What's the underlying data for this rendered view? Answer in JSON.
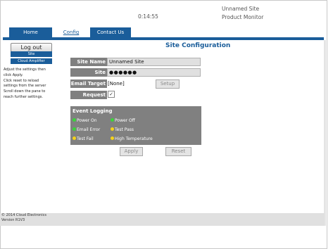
{
  "header": {
    "time": "0:14:55",
    "site_name": "Unnamed Site",
    "product": "Product Monitor"
  },
  "tabs": {
    "home": "Home",
    "config": "Config",
    "contact": "Contact Us"
  },
  "sidebar": {
    "logout_label": "Log out",
    "items": [
      "Site",
      "Cloud Amplifier"
    ],
    "help_lines": [
      "Adjust the settings then",
      "click Apply.",
      "Click reset to reload",
      "settings from the server",
      "Scroll down the pane to",
      "reach further settings."
    ]
  },
  "main": {
    "title": "Site Configuration",
    "site_name_label": "Site Name",
    "site_name_value": "Unnamed Site",
    "password_label": "Site Password",
    "password_value": "●●●●●●",
    "email_label": "Email Target",
    "email_value": "[None]",
    "setup_label": "Setup",
    "request_login_label": "Request Login",
    "request_login_checked": true,
    "check_mark": "✓",
    "event_logging": {
      "title": "Event Logging",
      "items": [
        {
          "label": "Power On",
          "color": "#3cd23c"
        },
        {
          "label": "Power Off",
          "color": "#3cd23c"
        },
        {
          "label": "Email Error",
          "color": "#3cd23c"
        },
        {
          "label": "Test Pass",
          "color": "#f4d21a"
        },
        {
          "label": "Test Fail",
          "color": "#f4d21a"
        },
        {
          "label": "High Temperature",
          "color": "#f4d21a"
        }
      ]
    },
    "apply_label": "Apply",
    "reset_label": "Reset"
  },
  "footer": {
    "copyright": "© 2014 Cloud Electronics",
    "version": "Version R1V3"
  },
  "colors": {
    "accent": "#1a5d9a",
    "label_bg": "#808080"
  }
}
